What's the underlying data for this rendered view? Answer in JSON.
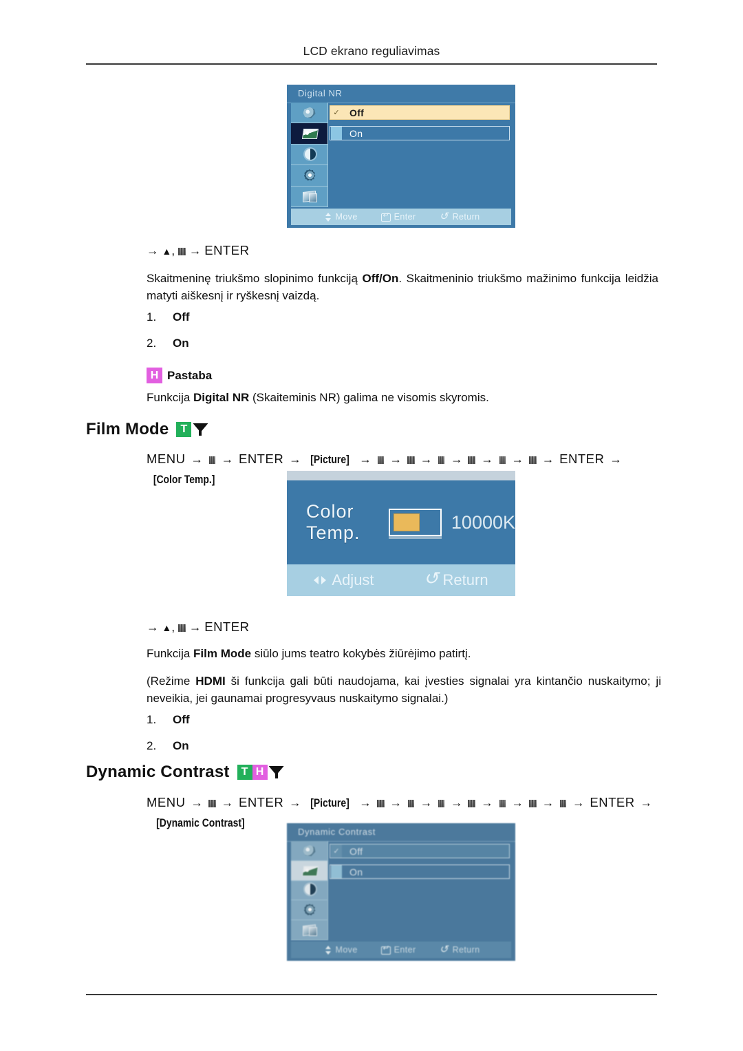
{
  "page": {
    "running_head": "LCD ekrano reguliavimas"
  },
  "section_digital_nr": {
    "osd": {
      "title": "Digital NR",
      "options": [
        {
          "label": "Off",
          "selected": true,
          "mark": "✓"
        },
        {
          "label": "On",
          "selected": false,
          "mark": ""
        }
      ],
      "sidebar_icons": [
        "sound-icon",
        "picture-icon",
        "contrast-icon",
        "setup-gear-icon",
        "multi-screen-icon"
      ],
      "footer": [
        {
          "icon": "move-icon",
          "label": "Move"
        },
        {
          "icon": "enter-icon",
          "label": "Enter"
        },
        {
          "icon": "return-icon",
          "label": "Return"
        }
      ]
    },
    "nav_line": {
      "prefix_arrow": "→",
      "up_glyph": "▲",
      "comma": ",",
      "mid_arrow": "→",
      "enter": "ENTER"
    },
    "paragraph": "Skaitmeninę triukšmo slopinimo funkciją Off/On. Skaitmeninio triukšmo mažinimo funkcija leidžia matyti aiškesnį ir ryškesnį vaizdą.",
    "paragraph_parts": {
      "a": "Skaitmeninę triukšmo slopinimo funkciją ",
      "b": "Off/On",
      "c": ". Skaitmeninio triukšmo mažinimo funkcija leidžia matyti aiškesnį ir ryškesnį vaizdą."
    },
    "list": [
      {
        "index": "1.",
        "value": "Off"
      },
      {
        "index": "2.",
        "value": "On"
      }
    ],
    "note": {
      "badge": "H",
      "badge_color": "#e25fe0",
      "label": "Pastaba",
      "text_a": "Funkcija ",
      "text_b": "Digital NR",
      "text_c": " (Skaiteminis NR) galima ne visomis skyromis."
    }
  },
  "section_film_mode": {
    "heading": {
      "title": "Film Mode",
      "badges": [
        {
          "letter": "T",
          "color": "#22b05a"
        }
      ],
      "funnel_icon": "funnel-icon"
    },
    "nav_line": {
      "menu": "MENU",
      "arrow": "→",
      "enter": "ENTER",
      "picture": "[Picture]",
      "color_temp": "[Color Temp.]"
    },
    "osd": {
      "label": "Color Temp.",
      "value": "10000K",
      "fill_percent": 52,
      "fill_color": "#eab95a",
      "footer": [
        {
          "icon": "adjust-icon",
          "label": "Adjust"
        },
        {
          "icon": "return-icon",
          "label": "Return"
        }
      ]
    },
    "nav_line2": {
      "prefix_arrow": "→",
      "up_glyph": "▲",
      "comma": ",",
      "mid_arrow": "→",
      "enter": "ENTER"
    },
    "paragraph1_a": "Funkcija ",
    "paragraph1_b": "Film Mode",
    "paragraph1_c": " siūlo jums teatro kokybės žiūrėjimo patirtį.",
    "paragraph2_a": "(Režime ",
    "paragraph2_b": "HDMI",
    "paragraph2_c": " ši funkcija gali būti naudojama, kai įvesties signalai yra kintančio nuskaitymo; ji neveikia, jei gaunamai progresyvaus nuskaitymo signalai.)",
    "list": [
      {
        "index": "1.",
        "value": "Off"
      },
      {
        "index": "2.",
        "value": "On"
      }
    ]
  },
  "section_dynamic_contrast": {
    "heading": {
      "title": "Dynamic Contrast",
      "badges": [
        {
          "letter": "T",
          "color": "#22b05a"
        },
        {
          "letter": "H",
          "color": "#e25fe0"
        }
      ],
      "funnel_icon": "funnel-icon"
    },
    "nav_line": {
      "menu": "MENU",
      "arrow": "→",
      "enter": "ENTER",
      "picture": "[Picture]",
      "dynamic_contrast": "[Dynamic Contrast]"
    },
    "osd": {
      "title": "Dynamic Contrast",
      "options": [
        {
          "label": "Off",
          "selected": true,
          "mark": "✓"
        },
        {
          "label": "On",
          "selected": false,
          "mark": ""
        }
      ],
      "sidebar_icons": [
        "sound-icon",
        "picture-icon",
        "contrast-icon",
        "setup-gear-icon",
        "multi-screen-icon"
      ],
      "footer": [
        {
          "icon": "move-icon",
          "label": "Move"
        },
        {
          "icon": "enter-icon",
          "label": "Enter"
        },
        {
          "icon": "return-icon",
          "label": "Return"
        }
      ]
    }
  }
}
